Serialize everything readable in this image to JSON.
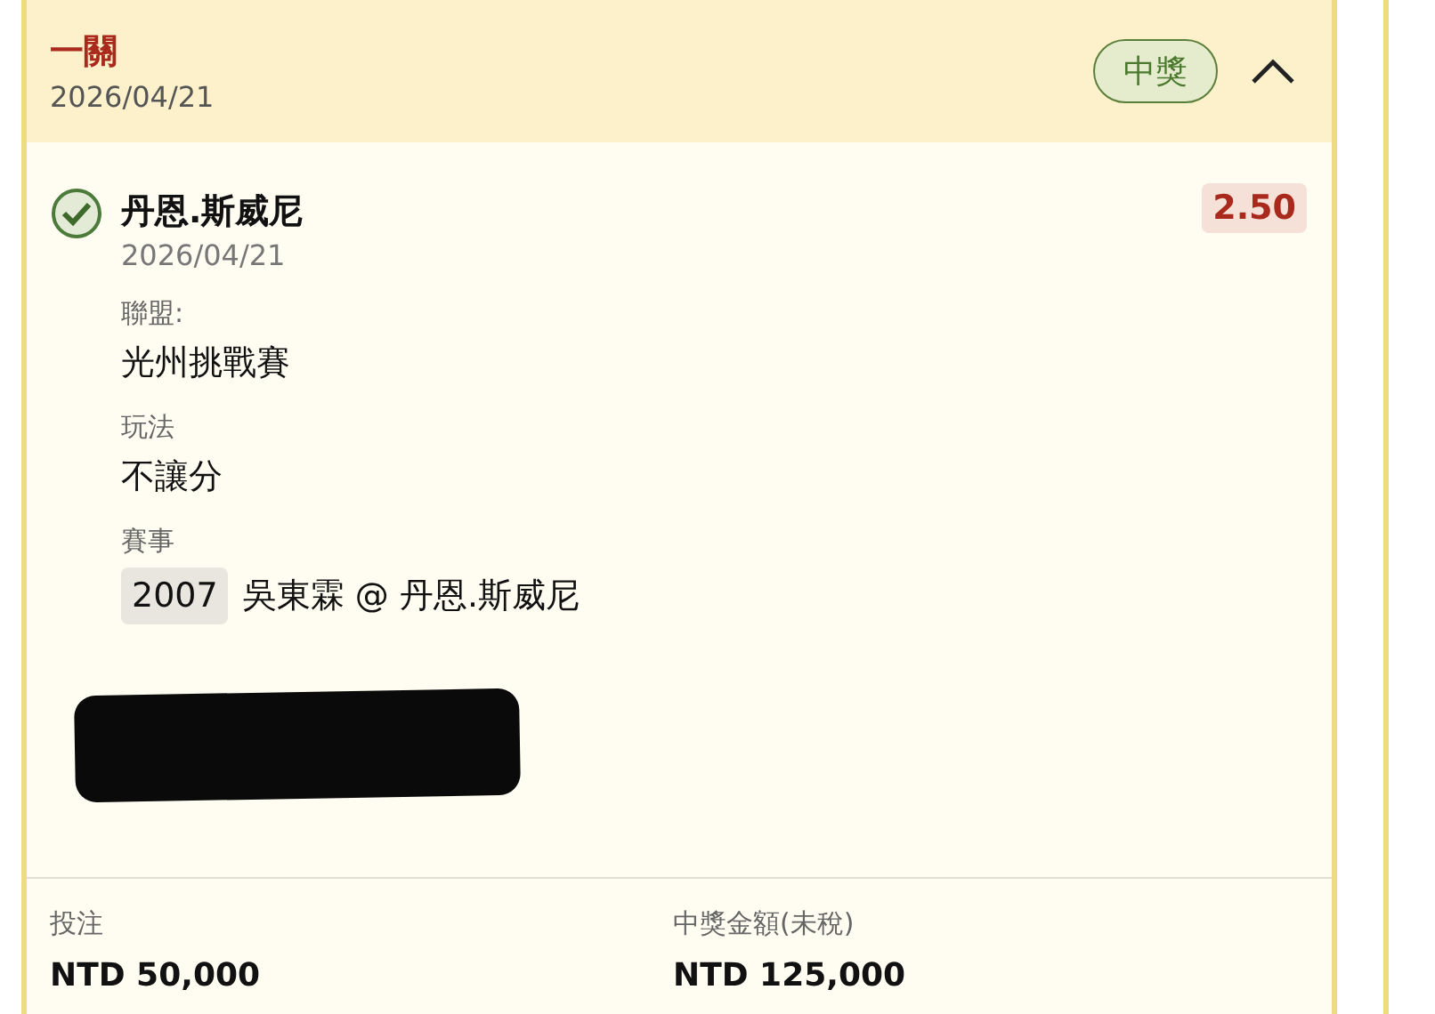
{
  "ticket": {
    "title": "一關",
    "date": "2026/04/21",
    "status": {
      "label": "中獎",
      "kind": "won"
    },
    "expanded": true,
    "selections": [
      {
        "won": true,
        "name": "丹恩.斯威尼",
        "date": "2026/04/21",
        "odds": "2.50",
        "fields": [
          {
            "label": "聯盟:",
            "value": "光州挑戰賽"
          },
          {
            "label": "玩法",
            "value": "不讓分"
          }
        ],
        "event": {
          "label": "賽事",
          "code": "2007",
          "matchup": "吳東霖 @ 丹恩.斯威尼"
        }
      }
    ],
    "summary": [
      {
        "label": "投注",
        "value": "NTD 50,000"
      },
      {
        "label": "中獎金額(未稅)",
        "value": "NTD 125,000"
      }
    ]
  }
}
